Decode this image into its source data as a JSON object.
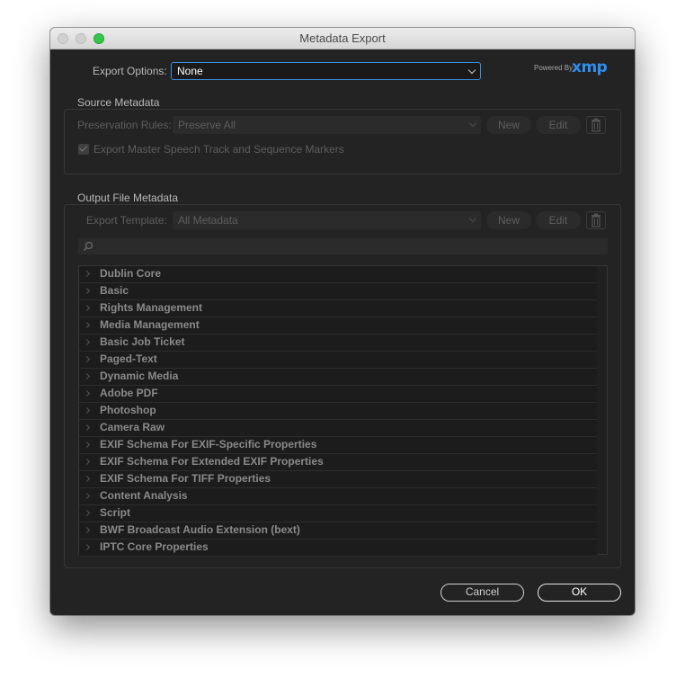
{
  "window": {
    "title": "Metadata Export"
  },
  "export_options": {
    "label": "Export Options:",
    "value": "None"
  },
  "branding": {
    "powered_by": "Powered By",
    "logo": "xmp",
    "color": "#2d8ff0"
  },
  "source_metadata": {
    "title": "Source Metadata",
    "preservation_label": "Preservation Rules:",
    "preservation_value": "Preserve All",
    "new_label": "New",
    "edit_label": "Edit",
    "checkbox_label": "Export Master Speech Track and Sequence Markers",
    "checkbox_checked": true
  },
  "output_metadata": {
    "title": "Output File Metadata",
    "template_label": "Export Template:",
    "template_value": "All Metadata",
    "new_label": "New",
    "edit_label": "Edit",
    "search_placeholder": "",
    "schemas": [
      "Dublin Core",
      "Basic",
      "Rights Management",
      "Media Management",
      "Basic Job Ticket",
      "Paged-Text",
      "Dynamic Media",
      "Adobe PDF",
      "Photoshop",
      "Camera Raw",
      "EXIF Schema For EXIF-Specific Properties",
      "EXIF Schema For Extended EXIF Properties",
      "EXIF Schema For TIFF Properties",
      "Content Analysis",
      "Script",
      "BWF Broadcast Audio Extension (bext)",
      "IPTC Core Properties"
    ]
  },
  "footer": {
    "cancel_label": "Cancel",
    "ok_label": "OK"
  }
}
